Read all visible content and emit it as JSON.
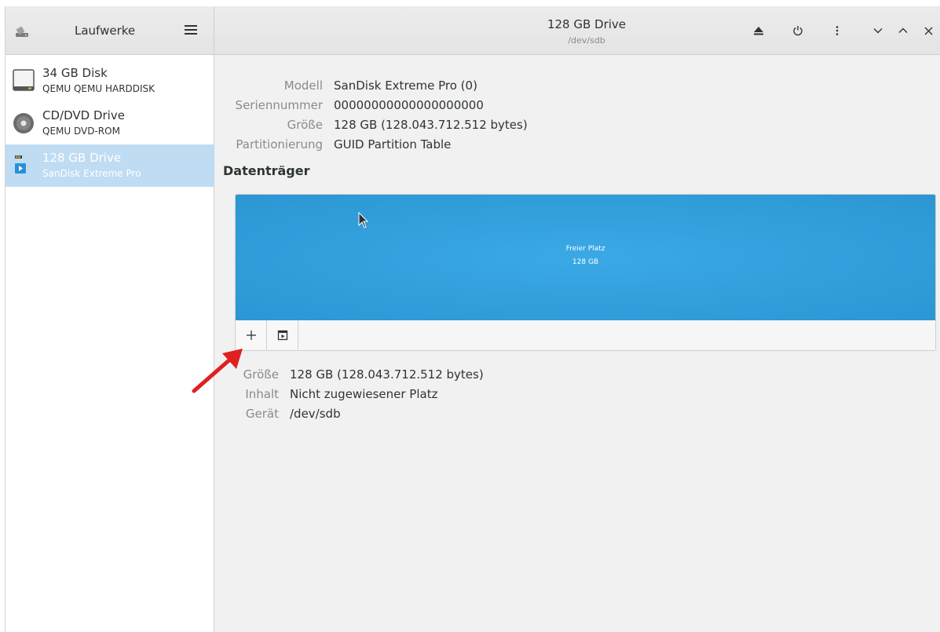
{
  "sidebar": {
    "title": "Laufwerke",
    "drives": [
      {
        "name": "34 GB Disk",
        "model": "QEMU QEMU HARDDISK"
      },
      {
        "name": "CD/DVD Drive",
        "model": "QEMU DVD-ROM"
      },
      {
        "name": "128 GB Drive",
        "model": "SanDisk Extreme Pro"
      }
    ]
  },
  "header": {
    "title": "128 GB Drive",
    "subtitle": "/dev/sdb"
  },
  "drive_info": {
    "model_label": "Modell",
    "model_value": "SanDisk Extreme Pro (0)",
    "serial_label": "Seriennummer",
    "serial_value": "00000000000000000000",
    "size_label": "Größe",
    "size_value": "128 GB (128.043.712.512 bytes)",
    "partitioning_label": "Partitionierung",
    "partitioning_value": "GUID Partition Table"
  },
  "volumes": {
    "title": "Datenträger",
    "block_label": "Freier Platz",
    "block_size": "128 GB"
  },
  "volume_info": {
    "size_label": "Größe",
    "size_value": "128 GB (128.043.712.512 bytes)",
    "content_label": "Inhalt",
    "content_value": "Nicht zugewiesener Platz",
    "device_label": "Gerät",
    "device_value": "/dev/sdb"
  },
  "colors": {
    "selection": "#bfdcf3",
    "free_space": "#3aa9e5",
    "annotation_arrow": "#e02020"
  },
  "icons": {
    "app": "disks-app-icon",
    "menu": "hamburger-menu-icon",
    "eject": "eject-icon",
    "power": "power-icon",
    "more": "vertical-dots-icon",
    "minimize": "chevron-down-icon",
    "maximize": "chevron-up-icon",
    "close": "close-icon",
    "add_partition": "plus-icon",
    "other_actions": "play-box-icon"
  }
}
